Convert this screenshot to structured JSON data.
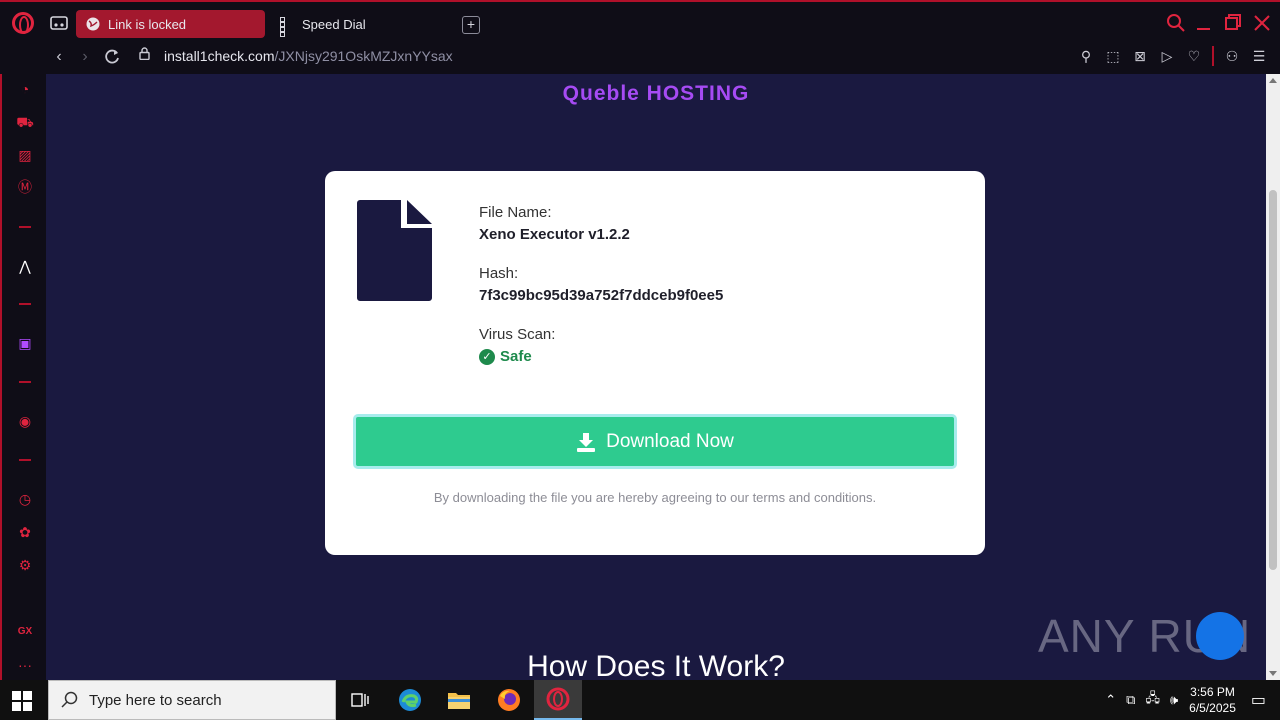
{
  "browser": {
    "tabs": [
      {
        "label": "Link is locked",
        "active": true
      },
      {
        "label": "Speed Dial",
        "active": false
      }
    ],
    "url_host": "install1check.com",
    "url_path": "/JXNjsy291OskMZJxnYYsax",
    "accent_color": "#b0102a"
  },
  "page": {
    "brand": "Queble HOSTING",
    "file_name_label": "File Name:",
    "file_name": "Xeno Executor v1.2.2",
    "hash_label": "Hash:",
    "hash": "7f3c99bc95d39a752f7ddceb9f0ee5",
    "virus_scan_label": "Virus Scan:",
    "virus_scan_result": "Safe",
    "download_button": "Download Now",
    "terms": "By downloading the file you are hereby agreeing to our terms and conditions.",
    "how_heading": "How Does It Work?",
    "watermark": "ANY RUN",
    "colors": {
      "background": "#1a1940",
      "button": "#2ecb8f",
      "brand": "#a64bf4",
      "safe": "#1e8a4c"
    }
  },
  "taskbar": {
    "search_placeholder": "Type here to search",
    "time": "3:56 PM",
    "date": "6/5/2025"
  }
}
